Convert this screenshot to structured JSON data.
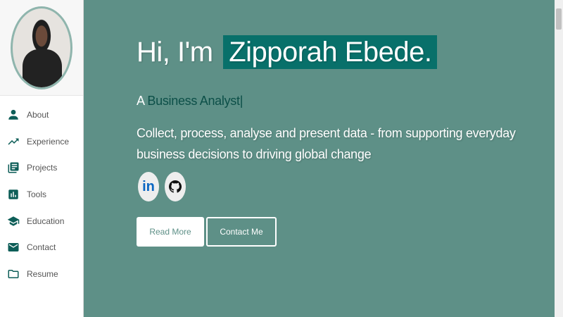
{
  "sidebar": {
    "items": [
      {
        "label": "About",
        "icon": "person-icon"
      },
      {
        "label": "Experience",
        "icon": "trending-up-icon"
      },
      {
        "label": "Projects",
        "icon": "library-books-icon"
      },
      {
        "label": "Tools",
        "icon": "bar-chart-icon"
      },
      {
        "label": "Education",
        "icon": "school-icon"
      },
      {
        "label": "Contact",
        "icon": "mail-icon"
      },
      {
        "label": "Resume",
        "icon": "folder-icon"
      }
    ]
  },
  "hero": {
    "greeting": "Hi, I'm",
    "name": "Zipporah Ebede.",
    "role_prefix": "A",
    "role": "Business Analyst|",
    "description": "Collect, process, analyse and present data - from supporting everyday business decisions to driving global change",
    "linkedin": "in",
    "read_more": "Read More",
    "contact_me": "Contact Me"
  },
  "colors": {
    "background": "#5e9087",
    "accent": "#08706a",
    "icon": "#0e5e58"
  }
}
